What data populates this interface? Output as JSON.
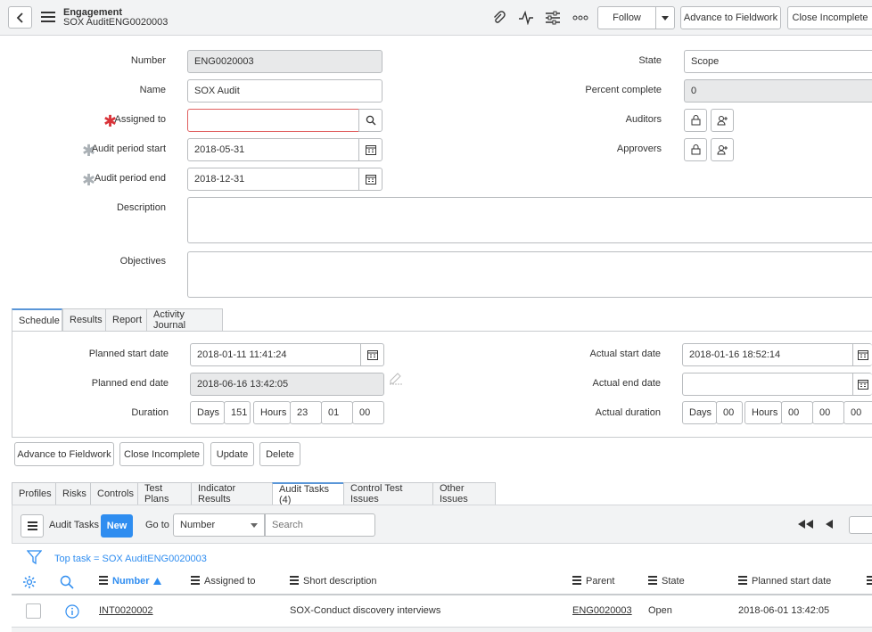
{
  "header": {
    "record_type": "Engagement",
    "record_title": "SOX AuditENG0020003",
    "follow": "Follow",
    "advance": "Advance to Fieldwork",
    "close_incomplete": "Close Incomplete"
  },
  "form": {
    "number_label": "Number",
    "number_value": "ENG0020003",
    "name_label": "Name",
    "name_value": "SOX Audit",
    "assigned_label": "Assigned to",
    "assigned_value": "",
    "period_start_label": "Audit period start",
    "period_start_value": "2018-05-31",
    "period_end_label": "Audit period end",
    "period_end_value": "2018-12-31",
    "description_label": "Description",
    "description_value": "",
    "objectives_label": "Objectives",
    "objectives_value": "",
    "state_label": "State",
    "state_value": "Scope",
    "percent_label": "Percent complete",
    "percent_value": "0",
    "auditors_label": "Auditors",
    "approvers_label": "Approvers"
  },
  "section_tabs": [
    "Schedule",
    "Results",
    "Report",
    "Activity Journal"
  ],
  "schedule": {
    "planned_start_label": "Planned start date",
    "planned_start_value": "2018-01-11 11:41:24",
    "planned_end_label": "Planned end date",
    "planned_end_value": "2018-06-16 13:42:05",
    "duration_label": "Duration",
    "duration": {
      "days_label": "Days",
      "days": "151",
      "hours_label": "Hours",
      "h": "23",
      "m": "01",
      "s": "00"
    },
    "actual_start_label": "Actual start date",
    "actual_start_value": "2018-01-16 18:52:14",
    "actual_end_label": "Actual end date",
    "actual_end_value": "",
    "actual_duration_label": "Actual duration",
    "actual_duration": {
      "days_label": "Days",
      "days": "00",
      "hours_label": "Hours",
      "h": "00",
      "m": "00",
      "s": "00"
    }
  },
  "actions": [
    "Advance to Fieldwork",
    "Close Incomplete",
    "Update",
    "Delete"
  ],
  "related_tabs": [
    "Profiles",
    "Risks",
    "Controls",
    "Test Plans",
    "Indicator Results",
    "Audit Tasks (4)",
    "Control Test Issues",
    "Other Issues"
  ],
  "list": {
    "title": "Audit Tasks",
    "new_label": "New",
    "goto_label": "Go to",
    "goto_select": "Number",
    "search_placeholder": "Search",
    "filter_text": "Top task = SOX AuditENG0020003",
    "columns": [
      "Number",
      "Assigned to",
      "Short description",
      "Parent",
      "State",
      "Planned start date"
    ],
    "rows": [
      {
        "number": "INT0020002",
        "assigned": "",
        "short_description": "SOX-Conduct discovery interviews",
        "parent": "ENG0020003",
        "state": "Open",
        "planned_start": "2018-06-01 13:42:05"
      }
    ]
  }
}
